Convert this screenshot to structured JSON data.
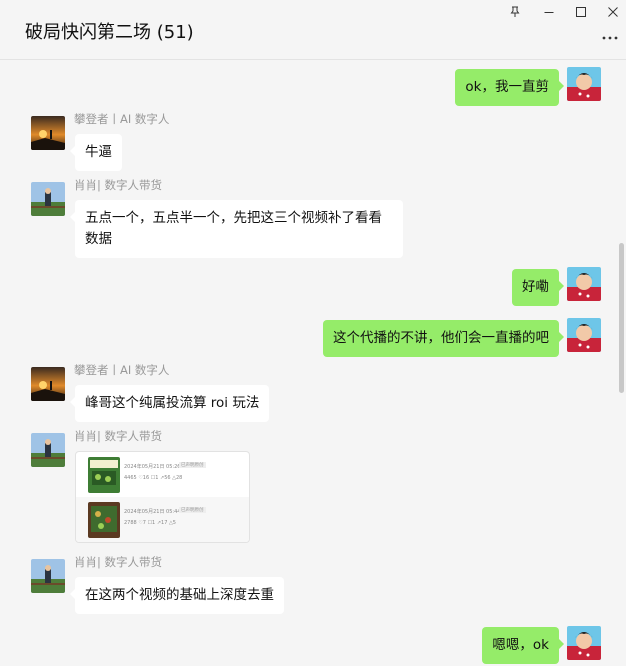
{
  "window": {
    "title": "破局快闪第二场 (51)",
    "controls": [
      "pin-icon",
      "minimize-icon",
      "maximize-icon",
      "close-icon"
    ],
    "more_icon": "more-icon"
  },
  "messages": [
    {
      "dir": "out",
      "text": "ok，我一直剪"
    },
    {
      "dir": "in",
      "sender": "攀登者丨AI 数字人",
      "text": "牛逼"
    },
    {
      "dir": "in",
      "sender": "肖肖| 数字人带货",
      "lines": [
        "五点一个，五点半一个，先把这三个视频补了看看",
        "数据"
      ]
    },
    {
      "dir": "out",
      "text": "好嘞"
    },
    {
      "dir": "out",
      "text": "这个代播的不讲，他们会一直播的吧"
    },
    {
      "dir": "in",
      "sender": "攀登者丨AI 数字人",
      "text": "峰哥这个纯属投流算 roi 玩法"
    },
    {
      "dir": "in",
      "sender": "肖肖| 数字人带货",
      "type": "video-card",
      "videos": [
        {
          "time": "2024年05月21日 05:26",
          "tag": "已声明原创",
          "stats": "4465  ♡16  ☐1  ↗56  △28"
        },
        {
          "time": "2024年05月21日 05:44",
          "tag": "已声明原创",
          "stats": "2788  ♡7  ☐1  ↗17  △5"
        }
      ]
    },
    {
      "dir": "in",
      "sender": "肖肖| 数字人带货",
      "text": "在这两个视频的基础上深度去重"
    },
    {
      "dir": "out",
      "text": "嗯嗯，ok"
    }
  ],
  "colors": {
    "outgoing_bubble": "#95ec69",
    "incoming_bubble": "#ffffff",
    "background": "#f5f5f5"
  }
}
